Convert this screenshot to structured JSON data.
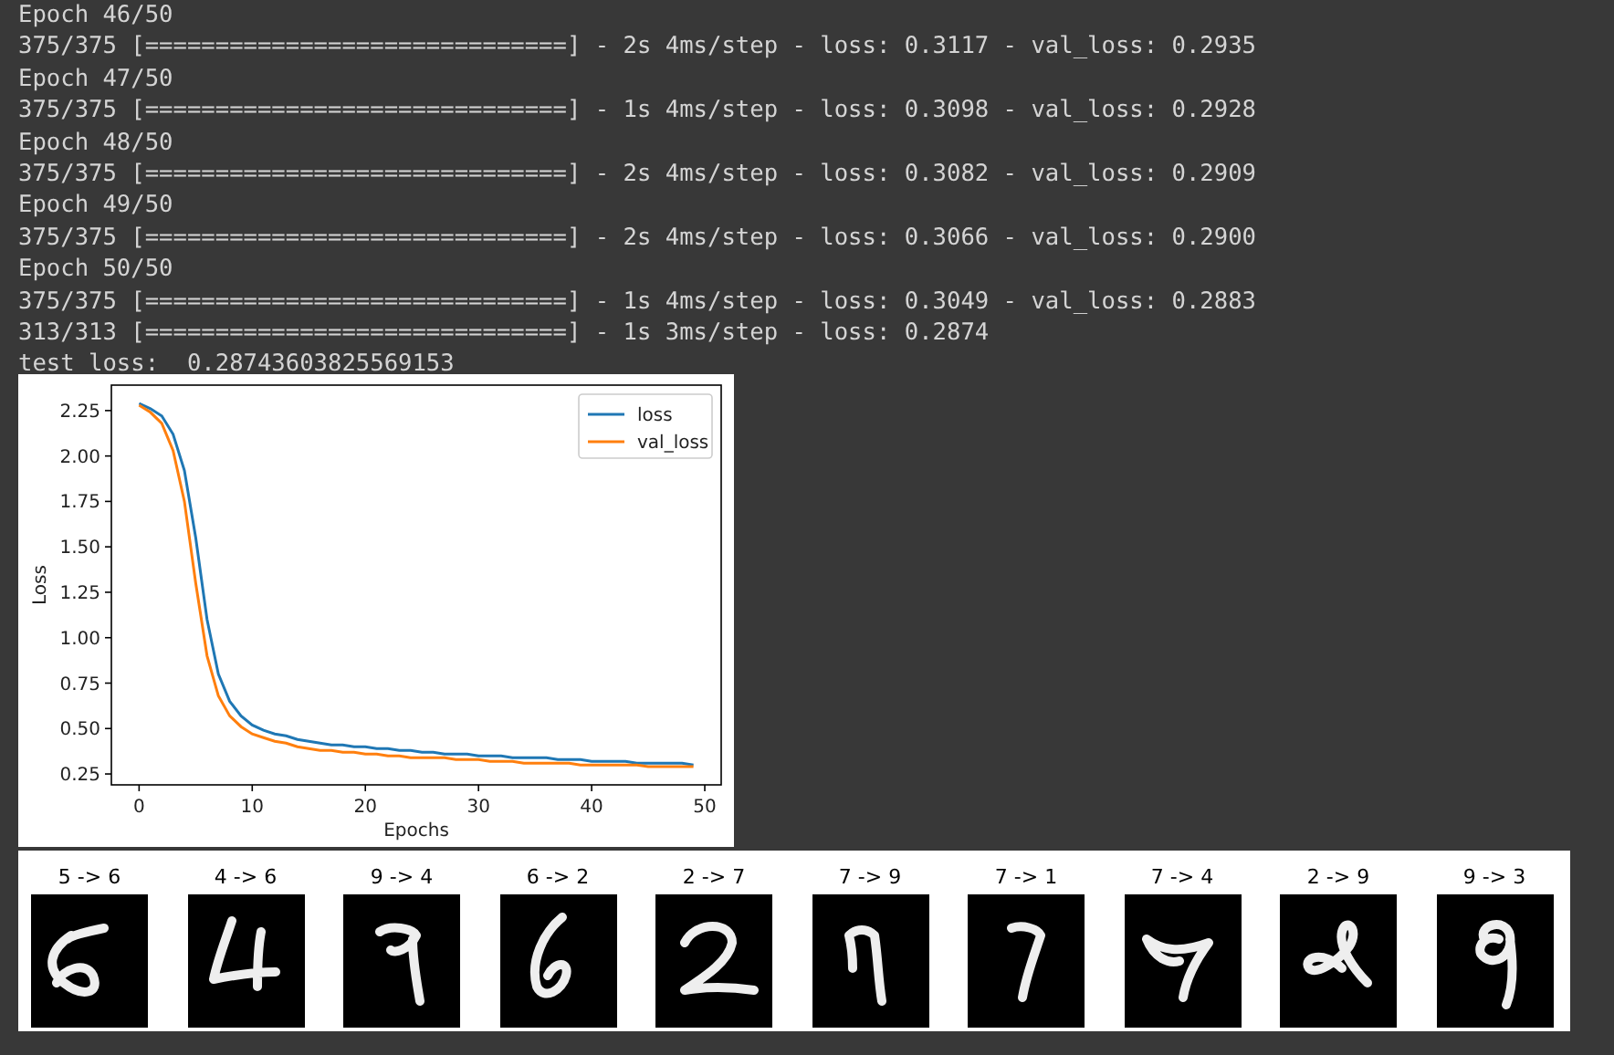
{
  "console": {
    "lines": [
      "Epoch 46/50",
      "375/375 [==============================] - 2s 4ms/step - loss: 0.3117 - val_loss: 0.2935",
      "Epoch 47/50",
      "375/375 [==============================] - 1s 4ms/step - loss: 0.3098 - val_loss: 0.2928",
      "Epoch 48/50",
      "375/375 [==============================] - 2s 4ms/step - loss: 0.3082 - val_loss: 0.2909",
      "Epoch 49/50",
      "375/375 [==============================] - 2s 4ms/step - loss: 0.3066 - val_loss: 0.2900",
      "Epoch 50/50",
      "375/375 [==============================] - 1s 4ms/step - loss: 0.3049 - val_loss: 0.2883",
      "313/313 [==============================] - 1s 3ms/step - loss: 0.2874",
      "test loss:  0.28743603825569153"
    ]
  },
  "loss_plot": {
    "chart_data": {
      "type": "line",
      "xlabel": "Epochs",
      "ylabel": "Loss",
      "x": [
        0,
        1,
        2,
        3,
        4,
        5,
        6,
        7,
        8,
        9,
        10,
        11,
        12,
        13,
        14,
        15,
        16,
        17,
        18,
        19,
        20,
        21,
        22,
        23,
        24,
        25,
        26,
        27,
        28,
        29,
        30,
        31,
        32,
        33,
        34,
        35,
        36,
        37,
        38,
        39,
        40,
        41,
        42,
        43,
        44,
        45,
        46,
        47,
        48,
        49
      ],
      "series": [
        {
          "name": "loss",
          "color": "#1f77b4",
          "values": [
            2.29,
            2.26,
            2.22,
            2.12,
            1.92,
            1.55,
            1.1,
            0.8,
            0.65,
            0.57,
            0.52,
            0.49,
            0.47,
            0.46,
            0.44,
            0.43,
            0.42,
            0.41,
            0.41,
            0.4,
            0.4,
            0.39,
            0.39,
            0.38,
            0.38,
            0.37,
            0.37,
            0.36,
            0.36,
            0.36,
            0.35,
            0.35,
            0.35,
            0.34,
            0.34,
            0.34,
            0.34,
            0.33,
            0.33,
            0.33,
            0.32,
            0.32,
            0.32,
            0.32,
            0.31,
            0.31,
            0.31,
            0.31,
            0.31,
            0.3
          ]
        },
        {
          "name": "val_loss",
          "color": "#ff7f0e",
          "values": [
            2.28,
            2.24,
            2.18,
            2.03,
            1.75,
            1.3,
            0.9,
            0.68,
            0.57,
            0.51,
            0.47,
            0.45,
            0.43,
            0.42,
            0.4,
            0.39,
            0.38,
            0.38,
            0.37,
            0.37,
            0.36,
            0.36,
            0.35,
            0.35,
            0.34,
            0.34,
            0.34,
            0.34,
            0.33,
            0.33,
            0.33,
            0.32,
            0.32,
            0.32,
            0.31,
            0.31,
            0.31,
            0.31,
            0.31,
            0.3,
            0.3,
            0.3,
            0.3,
            0.3,
            0.3,
            0.29,
            0.29,
            0.29,
            0.29,
            0.29
          ]
        }
      ],
      "legend": "upper right",
      "xlim": [
        -2.45,
        51.45
      ],
      "ylim": [
        0.19,
        2.39
      ],
      "xticks": [
        0,
        10,
        20,
        30,
        40,
        50
      ],
      "yticks": [
        {
          "value": 0.25,
          "label": "0.25"
        },
        {
          "value": 0.5,
          "label": "0.50"
        },
        {
          "value": 0.75,
          "label": "0.75"
        },
        {
          "value": 1,
          "label": "1.00"
        },
        {
          "value": 1.25,
          "label": "1.25"
        },
        {
          "value": 1.5,
          "label": "1.50"
        },
        {
          "value": 1.75,
          "label": "1.75"
        },
        {
          "value": 2,
          "label": "2.00"
        },
        {
          "value": 2.25,
          "label": "2.25"
        }
      ]
    }
  },
  "misclassified": [
    {
      "label": "5 -> 6"
    },
    {
      "label": "4 -> 6"
    },
    {
      "label": "9 -> 4"
    },
    {
      "label": "6 -> 2"
    },
    {
      "label": "2 -> 7"
    },
    {
      "label": "7 -> 9"
    },
    {
      "label": "7 -> 1"
    },
    {
      "label": "7 -> 4"
    },
    {
      "label": "2 -> 9"
    },
    {
      "label": "9 -> 3"
    }
  ]
}
